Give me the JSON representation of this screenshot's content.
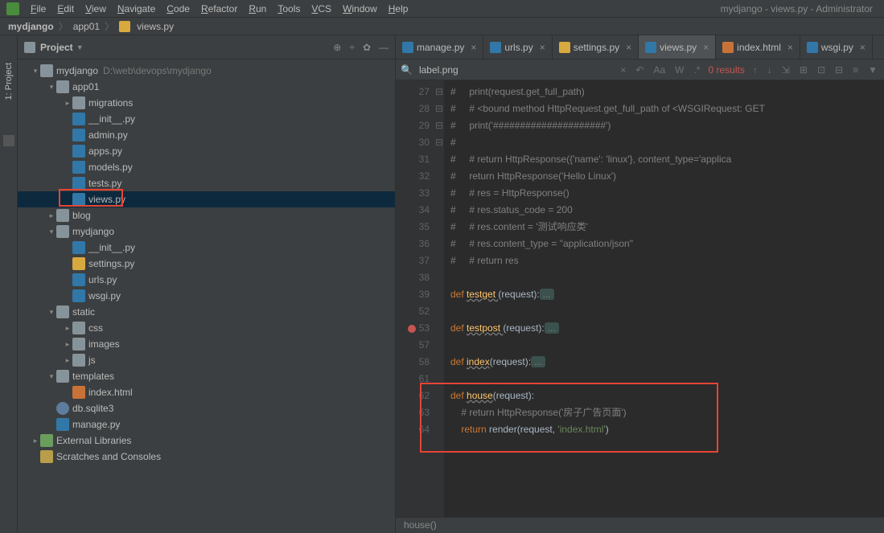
{
  "menu": {
    "items": [
      "File",
      "Edit",
      "View",
      "Navigate",
      "Code",
      "Refactor",
      "Run",
      "Tools",
      "VCS",
      "Window",
      "Help"
    ],
    "title": "mydjango - views.py - Administrator"
  },
  "breadcrumb": {
    "root": "mydjango",
    "mid": "app01",
    "file": "views.py"
  },
  "left_gutter": {
    "label": "1: Project"
  },
  "sidebar": {
    "title": "Project",
    "tree": [
      {
        "d": 0,
        "arrow": "v",
        "icon": "folder-root",
        "label": "mydjango",
        "path": "D:\\web\\devops\\mydjango"
      },
      {
        "d": 1,
        "arrow": "v",
        "icon": "folder",
        "label": "app01"
      },
      {
        "d": 2,
        "arrow": ">",
        "icon": "folder",
        "label": "migrations"
      },
      {
        "d": 2,
        "arrow": "",
        "icon": "py",
        "label": "__init__.py"
      },
      {
        "d": 2,
        "arrow": "",
        "icon": "py",
        "label": "admin.py"
      },
      {
        "d": 2,
        "arrow": "",
        "icon": "py",
        "label": "apps.py"
      },
      {
        "d": 2,
        "arrow": "",
        "icon": "py",
        "label": "models.py"
      },
      {
        "d": 2,
        "arrow": "",
        "icon": "py",
        "label": "tests.py"
      },
      {
        "d": 2,
        "arrow": "",
        "icon": "py",
        "label": "views.py",
        "selected": true
      },
      {
        "d": 1,
        "arrow": ">",
        "icon": "folder",
        "label": "blog"
      },
      {
        "d": 1,
        "arrow": "v",
        "icon": "folder",
        "label": "mydjango"
      },
      {
        "d": 2,
        "arrow": "",
        "icon": "py",
        "label": "__init__.py"
      },
      {
        "d": 2,
        "arrow": "",
        "icon": "py-dot",
        "label": "settings.py"
      },
      {
        "d": 2,
        "arrow": "",
        "icon": "py",
        "label": "urls.py"
      },
      {
        "d": 2,
        "arrow": "",
        "icon": "py",
        "label": "wsgi.py"
      },
      {
        "d": 1,
        "arrow": "v",
        "icon": "folder",
        "label": "static"
      },
      {
        "d": 2,
        "arrow": ">",
        "icon": "folder",
        "label": "css"
      },
      {
        "d": 2,
        "arrow": ">",
        "icon": "folder",
        "label": "images"
      },
      {
        "d": 2,
        "arrow": ">",
        "icon": "folder",
        "label": "js"
      },
      {
        "d": 1,
        "arrow": "v",
        "icon": "folder",
        "label": "templates"
      },
      {
        "d": 2,
        "arrow": "",
        "icon": "html",
        "label": "index.html"
      },
      {
        "d": 1,
        "arrow": "",
        "icon": "db",
        "label": "db.sqlite3"
      },
      {
        "d": 1,
        "arrow": "",
        "icon": "py",
        "label": "manage.py"
      },
      {
        "d": 0,
        "arrow": ">",
        "icon": "lib",
        "label": "External Libraries"
      },
      {
        "d": 0,
        "arrow": "",
        "icon": "scratch",
        "label": "Scratches and Consoles"
      }
    ]
  },
  "tabs": [
    {
      "icon": "py",
      "label": "manage.py",
      "active": false
    },
    {
      "icon": "py",
      "label": "urls.py",
      "active": false
    },
    {
      "icon": "py-dot",
      "label": "settings.py",
      "active": false
    },
    {
      "icon": "py",
      "label": "views.py",
      "active": true
    },
    {
      "icon": "html",
      "label": "index.html",
      "active": false
    },
    {
      "icon": "py",
      "label": "wsgi.py",
      "active": false
    }
  ],
  "search": {
    "query": "label.png",
    "results": "0 results"
  },
  "code": {
    "lines": [
      {
        "n": 27,
        "html": "<span class='c-comment'>#     print(request.get_full_path)</span>"
      },
      {
        "n": 28,
        "html": "<span class='c-comment'>#     # &lt;bound method HttpRequest.get_full_path of &lt;WSGIRequest: GET</span>"
      },
      {
        "n": 29,
        "html": "<span class='c-comment'>#     print('#####################')</span>"
      },
      {
        "n": 30,
        "html": "<span class='c-comment'>#</span>"
      },
      {
        "n": 31,
        "html": "<span class='c-comment'>#     # return HttpResponse({'name': 'linux'}, content_type='applica</span>"
      },
      {
        "n": 32,
        "html": "<span class='c-comment'>#     return HttpResponse('Hello Linux')</span>"
      },
      {
        "n": 33,
        "html": "<span class='c-comment'>#     # res = HttpResponse()</span>"
      },
      {
        "n": 34,
        "html": "<span class='c-comment'>#     # res.status_code = 200</span>"
      },
      {
        "n": 35,
        "html": "<span class='c-comment'>#     # res.content = '测试响应类'</span>"
      },
      {
        "n": 36,
        "html": "<span class='c-comment'>#     # res.content_type = \"application/json\"</span>"
      },
      {
        "n": 37,
        "html": "<span class='c-comment'>#     # return res</span>"
      },
      {
        "n": 38,
        "html": ""
      },
      {
        "n": 39,
        "fold": "-",
        "html": "<span class='c-kw'>def </span><span class='c-fn-u'>testget </span>(request):<span class='c-fold'>...</span>"
      },
      {
        "n": 52,
        "html": ""
      },
      {
        "n": 53,
        "fold": "-",
        "bp": true,
        "html": "<span class='c-kw'>def </span><span class='c-fn-u'>testpost </span>(request):<span class='c-fold'>...</span>"
      },
      {
        "n": 57,
        "html": ""
      },
      {
        "n": 58,
        "fold": "-",
        "html": "<span class='c-kw'>def </span><span class='c-fn-u'>index</span>(request):<span class='c-fold'>...</span>"
      },
      {
        "n": 61,
        "html": ""
      },
      {
        "n": 62,
        "fold": "-",
        "html": "<span class='c-kw'>def </span><span class='c-fn-u'>house</span>(request):"
      },
      {
        "n": 63,
        "html": "    <span class='c-comment'># return HttpResponse('房子广告页面')</span>"
      },
      {
        "n": 64,
        "html": "    <span class='c-kw'>return </span>render(request, <span class='c-str'>'index.html'</span>)"
      }
    ]
  },
  "status": {
    "text": "house()"
  }
}
